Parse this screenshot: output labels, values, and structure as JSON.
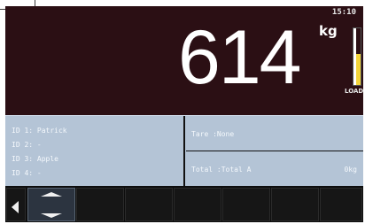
{
  "status": {
    "clock": "15:10"
  },
  "weight": {
    "value": "614",
    "unit": "kg",
    "load_label": "LOAD",
    "load_fraction": 0.55
  },
  "ids": [
    {
      "label": "ID 1: Patrick"
    },
    {
      "label": "ID 2: -"
    },
    {
      "label": "ID 3: Apple"
    },
    {
      "label": "ID 4: -"
    }
  ],
  "tare": {
    "label": "Tare  :None"
  },
  "total": {
    "label": "Total :Total A",
    "value": "0kg"
  },
  "softkeys": {
    "icons": [
      "left-arrow-icon",
      "up-down-icon"
    ],
    "colors": {
      "accent": "#f3d43a",
      "panel": "#b4c4d6",
      "display": "#2b0f14"
    }
  }
}
